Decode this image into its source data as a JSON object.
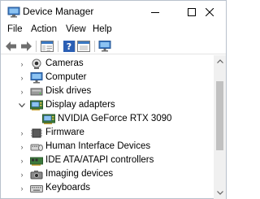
{
  "window": {
    "title": "Device Manager"
  },
  "menu": {
    "file": "File",
    "action": "Action",
    "view": "View",
    "help": "Help"
  },
  "toolbar": {
    "icons": [
      "back-arrow-icon",
      "forward-arrow-icon",
      "properties-icon",
      "help-icon",
      "update-driver-icon",
      "scan-monitor-icon"
    ]
  },
  "tree": {
    "items": [
      {
        "label": "Cameras",
        "expanded": false,
        "icon": "camera-icon"
      },
      {
        "label": "Computer",
        "expanded": false,
        "icon": "computer-icon"
      },
      {
        "label": "Disk drives",
        "expanded": false,
        "icon": "disk-drive-icon"
      },
      {
        "label": "Display adapters",
        "expanded": true,
        "icon": "display-adapter-icon"
      },
      {
        "label": "NVIDIA GeForce RTX 3090",
        "child": true,
        "icon": "display-adapter-icon"
      },
      {
        "label": "Firmware",
        "expanded": false,
        "icon": "firmware-icon"
      },
      {
        "label": "Human Interface Devices",
        "expanded": false,
        "icon": "hid-icon"
      },
      {
        "label": "IDE ATA/ATAPI controllers",
        "expanded": false,
        "icon": "ide-controller-icon"
      },
      {
        "label": "Imaging devices",
        "expanded": false,
        "icon": "imaging-device-icon"
      },
      {
        "label": "Keyboards",
        "expanded": false,
        "icon": "keyboard-icon"
      }
    ]
  },
  "colors": {
    "accent": "#2b79d0",
    "scrollbar_thumb": "#c1c1c1",
    "scrollbar_track": "#f0f0f0"
  }
}
